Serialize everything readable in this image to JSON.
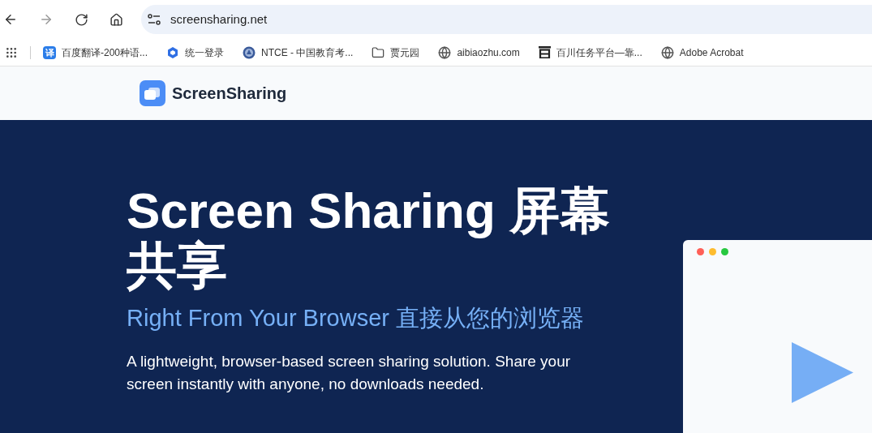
{
  "browser": {
    "url": "screensharing.net",
    "bookmarks": [
      {
        "kind": "translate",
        "icon_text": "译",
        "label": "百度翻译-200种语..."
      },
      {
        "kind": "hexagon",
        "label": "统一登录"
      },
      {
        "kind": "seal",
        "label": "NTCE - 中国教育考..."
      },
      {
        "kind": "folder",
        "label": "贾元园"
      },
      {
        "kind": "globe",
        "label": "aibiaozhu.com"
      },
      {
        "kind": "square",
        "label": "百川任务平台—靠..."
      },
      {
        "kind": "globe",
        "label": "Adobe Acrobat"
      }
    ]
  },
  "site": {
    "logo": "ScreenSharing"
  },
  "hero": {
    "title": "Screen Sharing 屏幕共享",
    "subtitle": "Right From Your Browser 直接从您的浏览器",
    "description": "A lightweight, browser-based screen sharing solution. Share your screen instantly with anyone, no downloads needed.",
    "mock_window": {
      "dots": [
        {
          "color": "#ff5f57"
        },
        {
          "color": "#febc2e"
        },
        {
          "color": "#28c840"
        }
      ]
    }
  }
}
